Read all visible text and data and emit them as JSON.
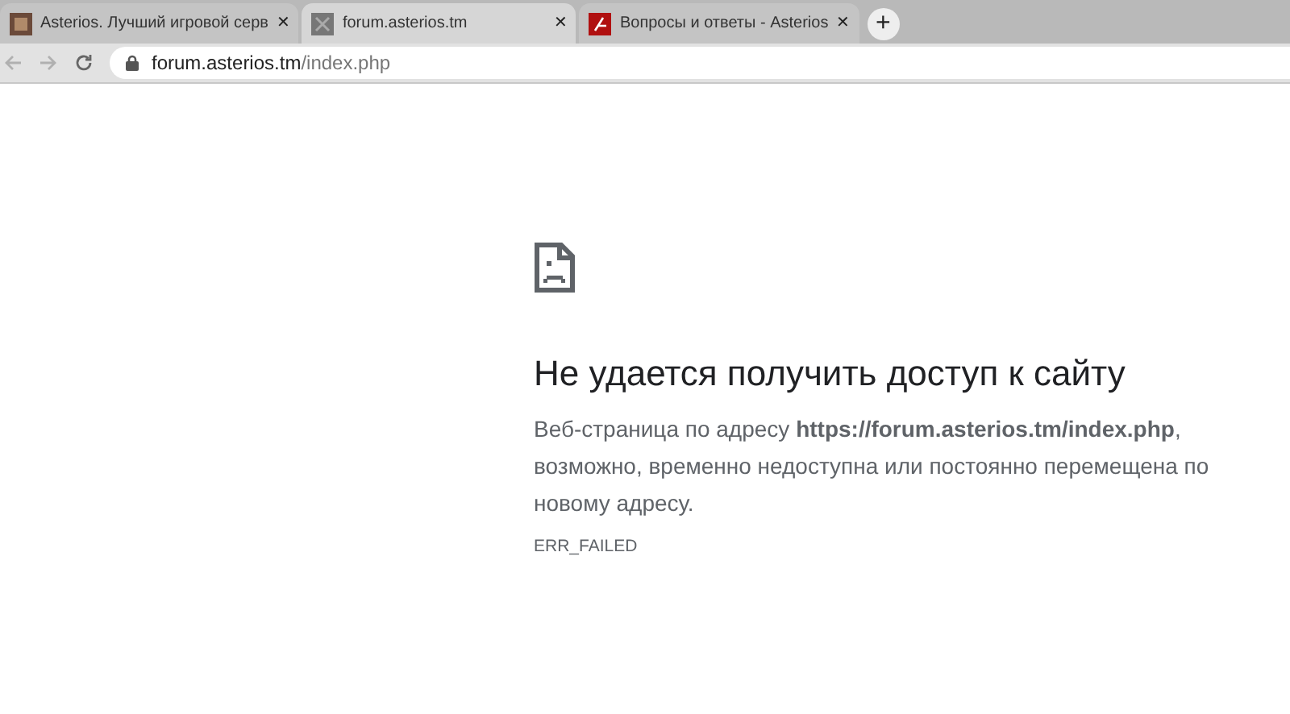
{
  "tabs": [
    {
      "title": "Asterios. Лучший игровой серв",
      "kind": "thumbnail",
      "selected": false,
      "close": "✕"
    },
    {
      "title": "forum.asterios.tm",
      "kind": "generic",
      "selected": true,
      "close": "✕"
    },
    {
      "title": "Вопросы и ответы - Asterios",
      "kind": "logo",
      "selected": false,
      "close": "✕"
    }
  ],
  "new_tab": "+",
  "address_bar": {
    "host": "forum.asterios.tm",
    "path": "/index.php"
  },
  "error": {
    "heading": "Не удается получить доступ к сайту",
    "message": "Веб-страница по адресу **https://forum.asterios.tm/index.php**, возможно, временно недоступна или постоянно перемещена по новому адресу.",
    "code": "ERR_FAILED"
  }
}
